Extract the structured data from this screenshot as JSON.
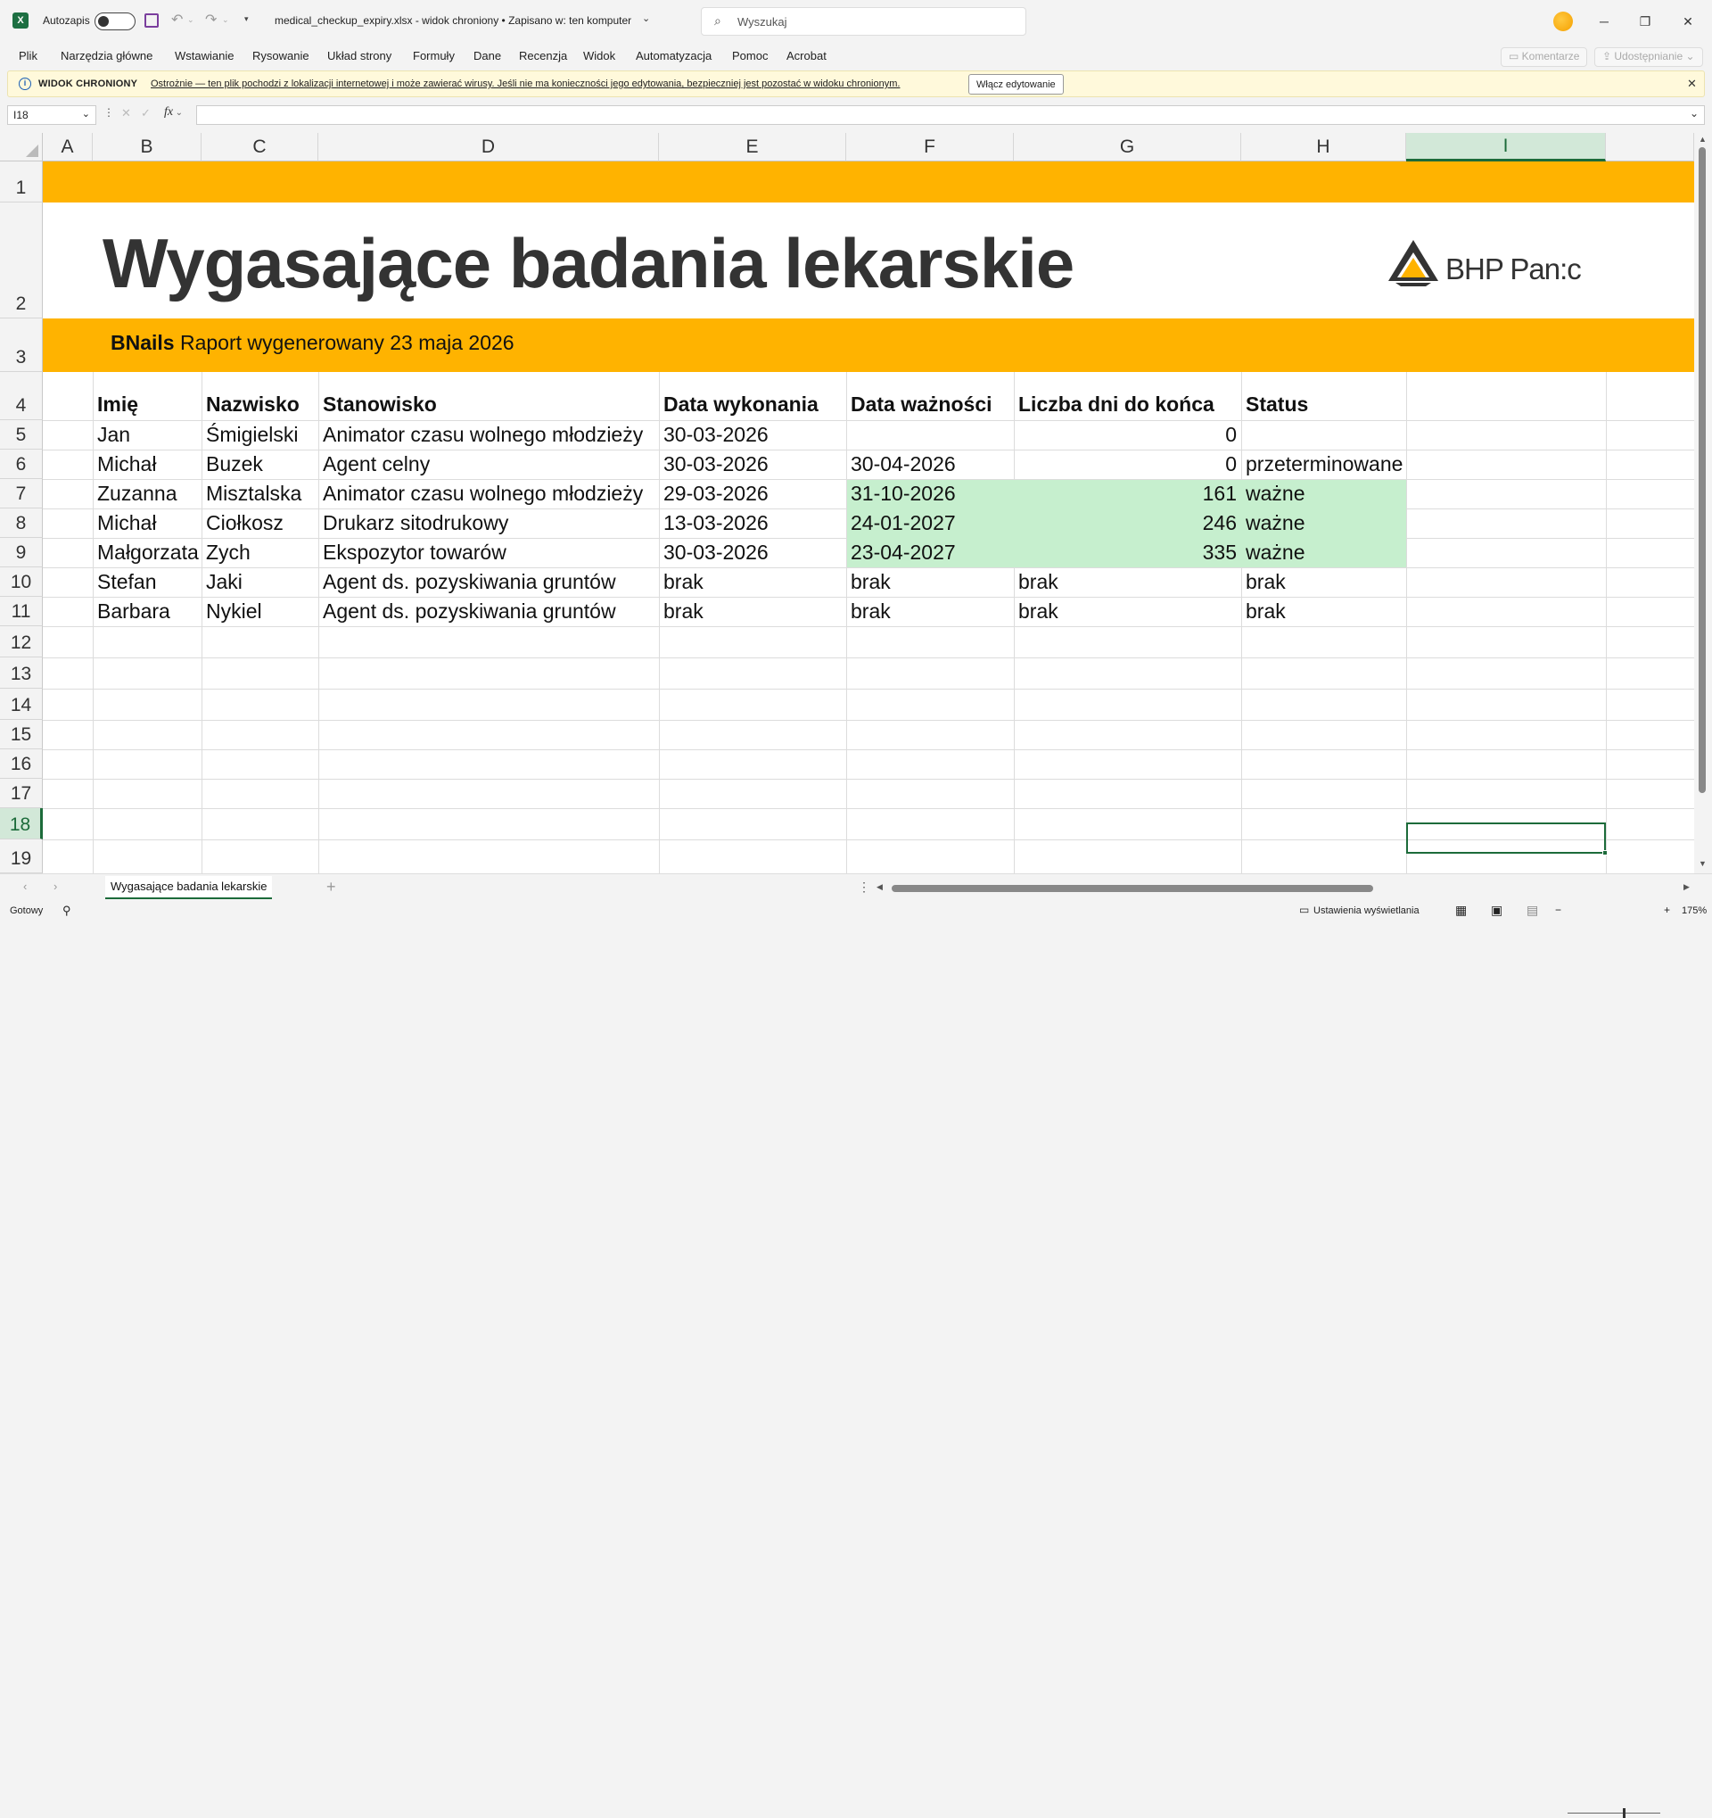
{
  "titlebar": {
    "autosave_label": "Autozapis",
    "file_title": "medical_checkup_expiry.xlsx  -  widok chroniony  •  Zapisano w: ten komputer",
    "search_placeholder": "Wyszukaj"
  },
  "menu": [
    "Plik",
    "Narzędzia główne",
    "Wstawianie",
    "Rysowanie",
    "Układ strony",
    "Formuły",
    "Dane",
    "Recenzja",
    "Widok",
    "Automatyzacja",
    "Pomoc",
    "Acrobat"
  ],
  "menu_right": {
    "comments": "Komentarze",
    "share": "Udostępnianie"
  },
  "protected_view": {
    "title": "WIDOK CHRONIONY",
    "message": "Ostrożnie — ten plik pochodzi z lokalizacji internetowej i może zawierać wirusy. Jeśli nie ma konieczności jego edytowania, bezpieczniej jest pozostać w widoku chronionym.",
    "enable_button": "Włącz edytowanie"
  },
  "formula_bar": {
    "name_box": "I18",
    "fx": "fx",
    "value": ""
  },
  "columns": [
    "A",
    "B",
    "C",
    "D",
    "E",
    "F",
    "G",
    "H",
    "I"
  ],
  "rows": [
    "1",
    "2",
    "3",
    "4",
    "5",
    "6",
    "7",
    "8",
    "9",
    "10",
    "11",
    "12",
    "13",
    "14",
    "15",
    "16",
    "17",
    "18",
    "19"
  ],
  "report": {
    "title": "Wygasające badania lekarskie",
    "company": "BNails",
    "subtitle": "Raport wygenerowany 23 maja 2026",
    "logo_text": "BHP Pan:c"
  },
  "table": {
    "headers": [
      "Imię",
      "Nazwisko",
      "Stanowisko",
      "Data wykonania",
      "Data ważności",
      "Liczba dni do końca",
      "Status"
    ],
    "rows": [
      [
        "Jan",
        "Śmigielski",
        "Animator czasu wolnego młodzieży",
        "30-03-2026",
        "",
        "0",
        ""
      ],
      [
        "Michał",
        "Buzek",
        "Agent celny",
        "30-03-2026",
        "30-04-2026",
        "0",
        "przeterminowane"
      ],
      [
        "Zuzanna",
        "Misztalska",
        "Animator czasu wolnego młodzieży",
        "29-03-2026",
        "31-10-2026",
        "161",
        "ważne"
      ],
      [
        "Michał",
        "Ciołkosz",
        "Drukarz sitodrukowy",
        "13-03-2026",
        "24-01-2027",
        "246",
        "ważne"
      ],
      [
        "Małgorzata",
        "Zych",
        "Ekspozytor towarów",
        "30-03-2026",
        "23-04-2027",
        "335",
        "ważne"
      ],
      [
        "Stefan",
        "Jaki",
        "Agent ds. pozyskiwania gruntów",
        "brak",
        "brak",
        "brak",
        "brak"
      ],
      [
        "Barbara",
        "Nykiel",
        "Agent ds. pozyskiwania gruntów",
        "brak",
        "brak",
        "brak",
        "brak"
      ]
    ]
  },
  "sheet_tab": "Wygasające badania lekarskie",
  "statusbar": {
    "ready": "Gotowy",
    "display_settings": "Ustawienia wyświetlania",
    "zoom": "175%"
  },
  "colors": {
    "accent": "#ffb300",
    "valid_fill": "#c6efce",
    "excel_green": "#1c6b3a"
  }
}
